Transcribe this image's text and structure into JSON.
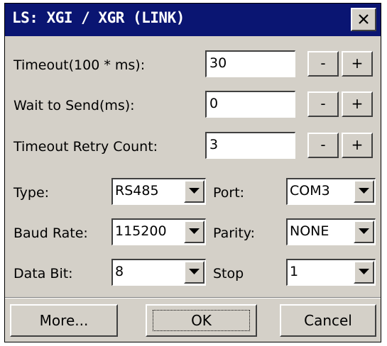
{
  "window": {
    "title": "LS: XGI / XGR (LINK)",
    "close_icon": "close-icon"
  },
  "fields": {
    "timeout": {
      "label": "Timeout(100 * ms):",
      "value": "30"
    },
    "wait_to_send": {
      "label": "Wait to Send(ms):",
      "value": "0"
    },
    "retry_count": {
      "label": "Timeout Retry Count:",
      "value": "3"
    }
  },
  "stepper": {
    "minus": "-",
    "plus": "+"
  },
  "serial": {
    "type": {
      "label": "Type:",
      "value": "RS485"
    },
    "port": {
      "label": "Port:",
      "value": "COM3"
    },
    "baud_rate": {
      "label": "Baud Rate:",
      "value": "115200"
    },
    "parity": {
      "label": "Parity:",
      "value": "NONE"
    },
    "data_bit": {
      "label": "Data Bit:",
      "value": "8"
    },
    "stop": {
      "label": "Stop",
      "value": "1"
    }
  },
  "buttons": {
    "more": "More...",
    "ok": "OK",
    "cancel": "Cancel"
  },
  "colors": {
    "titlebar": "#0a1572",
    "dialog_bg": "#d4d0c8"
  }
}
